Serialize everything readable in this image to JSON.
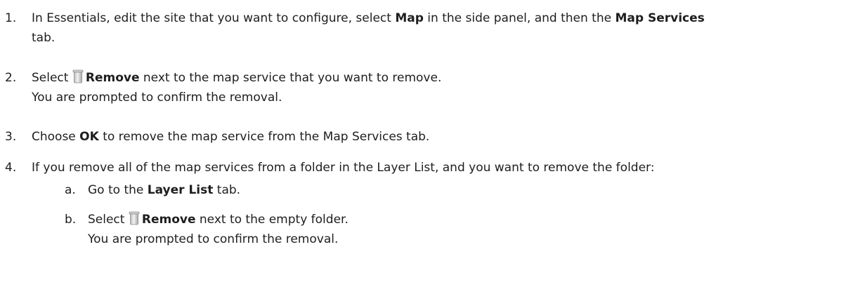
{
  "steps": [
    {
      "number": "1.",
      "line1": {
        "t1": "In Essentials, edit the site that you want to configure, select ",
        "b1": "Map",
        "t2": " in the side panel, and then the ",
        "b2": "Map Services"
      },
      "line2": "tab."
    },
    {
      "number": "2.",
      "t1": "Select ",
      "icon": "trash-icon",
      "b1": "Remove",
      "t2": " next to the map service that you want to remove.",
      "note": "You are prompted to confirm the removal."
    },
    {
      "number": "3.",
      "t1": "Choose ",
      "b1": "OK",
      "t2": " to remove the map service from the Map Services tab."
    },
    {
      "number": "4.",
      "text": "If you remove all of the map services from a folder in the Layer List, and you want to remove the folder:",
      "substeps": [
        {
          "letter": "a.",
          "t1": "Go to the ",
          "b1": "Layer List",
          "t2": " tab."
        },
        {
          "letter": "b.",
          "t1": "Select ",
          "icon": "trash-icon",
          "b1": "Remove",
          "t2": " next to the empty folder.",
          "note": "You are prompted to confirm the removal."
        }
      ]
    }
  ]
}
